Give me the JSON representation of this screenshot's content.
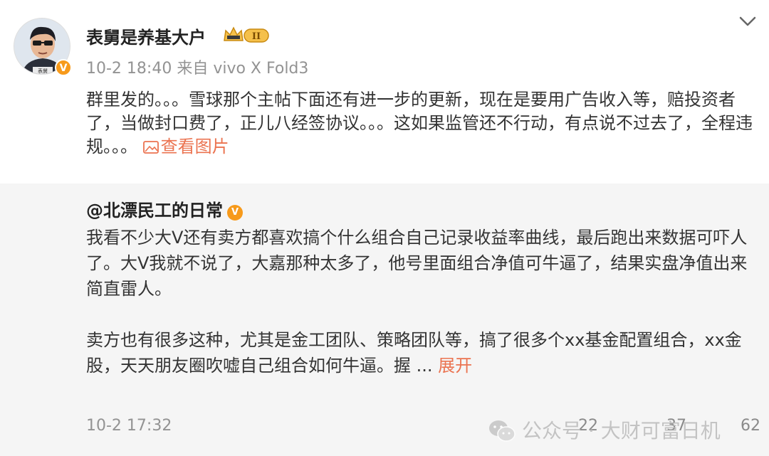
{
  "post": {
    "username": "表舅是养基大户",
    "level_badge": "II",
    "timestamp": "10-2 18:40",
    "source": "来自 vivo X Fold3",
    "avatar_caption": "表舅",
    "text": "群里发的。。。雪球那个主帖下面还有进一步的更新，现在是要用广告收入等，赔投资者了，当做封口费了，正儿八经签协议。。。这如果监管还不行动，有点说不过去了，全程违规。。。",
    "view_images_label": "查看图片",
    "verified_badge": "V"
  },
  "repost": {
    "author": "@北漂民工的日常",
    "verified_badge": "V",
    "paragraph1": "我看不少大V还有卖方都喜欢搞个什么组合自己记录收益率曲线，最后跑出来数据可吓人了。大V我就不说了，大嘉那种太多了，他号里面组合净值可牛逼了，结果实盘净值出来简直雷人。",
    "paragraph2": "卖方也有很多这种，尤其是金工团队、策略团队等，搞了很多个xx基金配置组合，xx金股，天天朋友圈吹嘘自己组合如何牛逼。握 ...",
    "expand_label": "展开",
    "timestamp": "10-2 17:32",
    "stats": {
      "reposts": "22",
      "comments": "37",
      "likes": "62"
    }
  },
  "watermark": {
    "text": "公众号 · 大财可富日机"
  },
  "colors": {
    "accent": "#eb7350",
    "verified": "#f79a1b",
    "repost_bg": "#f5f5f5",
    "meta": "#939393"
  }
}
